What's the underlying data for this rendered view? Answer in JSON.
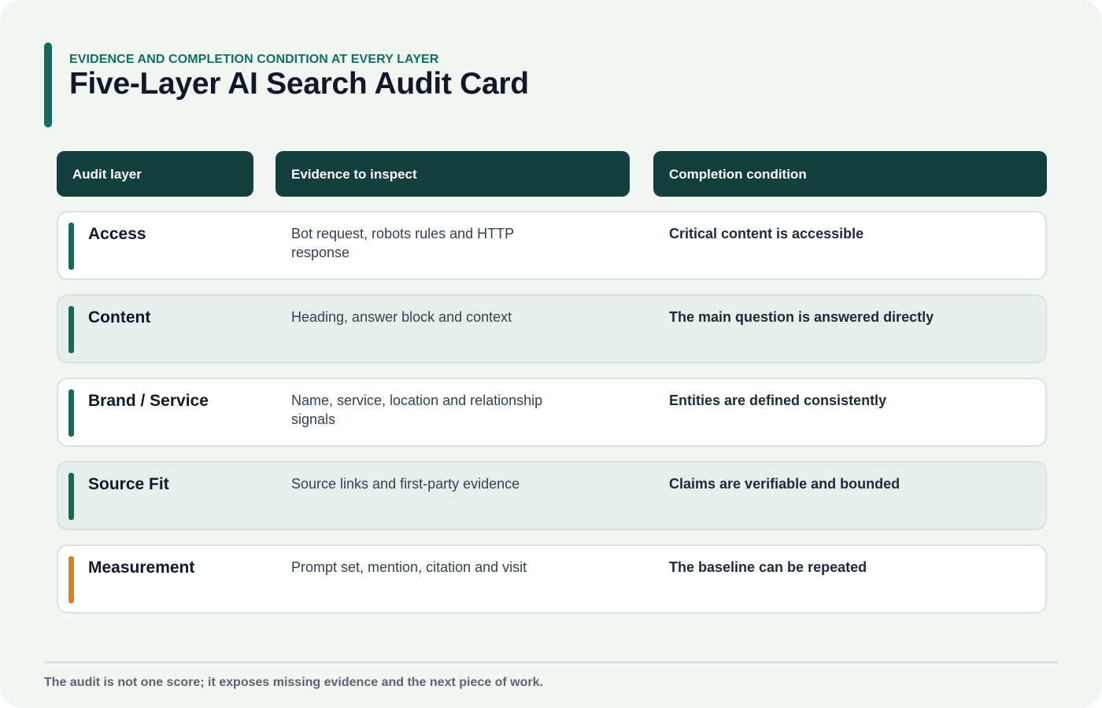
{
  "header": {
    "eyebrow": "EVIDENCE AND COMPLETION CONDITION AT EVERY LAYER",
    "title": "Five-Layer AI Search Audit Card"
  },
  "columns": [
    "Audit layer",
    "Evidence to inspect",
    "Completion condition"
  ],
  "rows": [
    {
      "layer": "Access",
      "evidence": "Bot request, robots rules and HTTP response",
      "condition": "Critical content is accessible",
      "accent": "#136b5c"
    },
    {
      "layer": "Content",
      "evidence": "Heading, answer block and context",
      "condition": "The main question is answered directly",
      "accent": "#136b5c"
    },
    {
      "layer": "Brand / Service",
      "evidence": "Name, service, location and relationship signals",
      "condition": "Entities are defined consistently",
      "accent": "#136b5c"
    },
    {
      "layer": "Source Fit",
      "evidence": "Source links and first-party evidence",
      "condition": "Claims are verifiable and bounded",
      "accent": "#136b5c"
    },
    {
      "layer": "Measurement",
      "evidence": "Prompt set, mention, citation and visit",
      "condition": "The baseline can be repeated",
      "accent": "#d9821c"
    }
  ],
  "footer": {
    "note": "The audit is not one score; it exposes missing evidence and the next piece of work."
  },
  "colors": {
    "accent_green": "#136b5c",
    "accent_orange": "#d9821c",
    "header_fill": "#133f3c",
    "background": "#f1f6f3"
  }
}
